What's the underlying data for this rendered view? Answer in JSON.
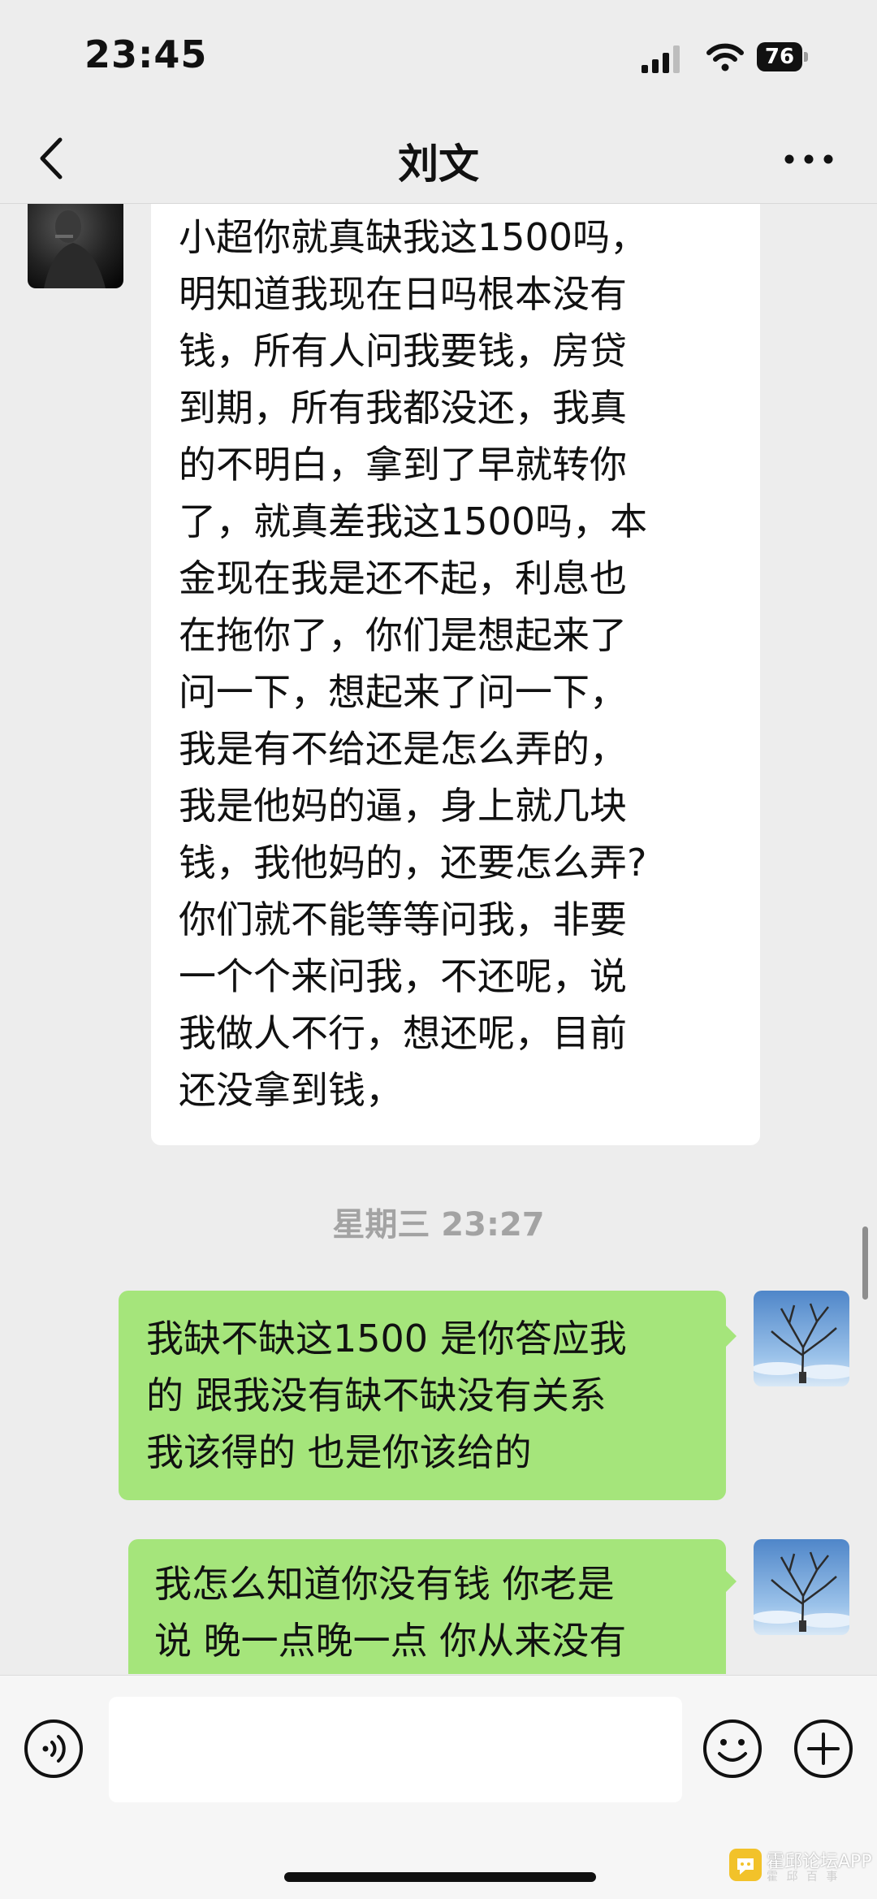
{
  "status_bar": {
    "time": "23:45",
    "battery": "76"
  },
  "header": {
    "title": "刘文"
  },
  "messages": [
    {
      "side": "left",
      "lines": [
        "小超你就真缺我这1500吗，",
        "明知道我现在日吗根本没有",
        "钱，所有人问我要钱，房贷",
        "到期，所有我都没还，我真",
        "的不明白，拿到了早就转你",
        "了，就真差我这1500吗，本",
        "金现在我是还不起，利息也",
        "在拖你了，你们是想起来了",
        "问一下，想起来了问一下，",
        "我是有不给还是怎么弄的，",
        "我是他妈的逼，身上就几块",
        "钱，我他妈的，还要怎么弄?",
        "你们就不能等等问我，非要",
        "一个个来问我，不还呢，说",
        "我做人不行，想还呢，目前",
        "还没拿到钱，"
      ]
    },
    {
      "side": "right",
      "lines": [
        "我缺不缺这1500 是你答应我",
        "的 跟我没有缺不缺没有关系",
        "我该得的 也是你该给的"
      ]
    },
    {
      "side": "right",
      "lines": [
        "我怎么知道你没有钱 你老是",
        "说 晚一点晚一点 你从来没有"
      ]
    }
  ],
  "timestamp": "星期三 23:27",
  "input": {
    "placeholder": ""
  },
  "watermark": {
    "title": "霍邱论坛APP",
    "subtitle": "霍 邱 百 事"
  },
  "icons": {
    "back": "back-arrow-icon",
    "more": "more-dots-icon",
    "voice": "voice-icon",
    "emoji": "emoji-icon",
    "plus": "plus-icon",
    "signal": "signal-icon",
    "wifi": "wifi-icon",
    "battery": "battery-icon"
  },
  "colors": {
    "sent_bubble": "#a5e57b",
    "received_bubble": "#ffffff",
    "background": "#ededed"
  }
}
